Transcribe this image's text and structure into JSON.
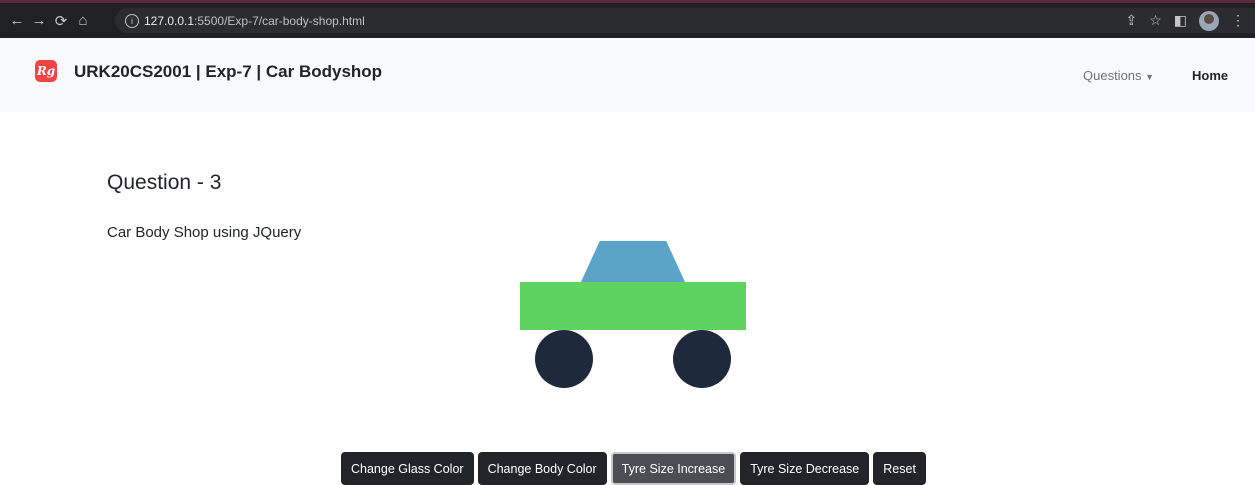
{
  "browser": {
    "url_host": "127.0.0.1",
    "url_rest": ":5500/Exp-7/car-body-shop.html",
    "info_icon": "info-icon"
  },
  "navbar": {
    "logo_text": "Rg",
    "title": "URK20CS2001 | Exp-7 | Car Bodyshop",
    "questions_label": "Questions",
    "home_label": "Home"
  },
  "main": {
    "question_title": "Question - 3",
    "question_subtitle": "Car Body Shop using JQuery"
  },
  "car": {
    "glass_color": "#5ba3c7",
    "body_color": "#5fd35f",
    "tyre_color": "#1e293b"
  },
  "buttons": {
    "glass": "Change Glass Color",
    "body": "Change Body Color",
    "tyre_increase": "Tyre Size Increase",
    "tyre_decrease": "Tyre Size Decrease",
    "reset": "Reset"
  }
}
